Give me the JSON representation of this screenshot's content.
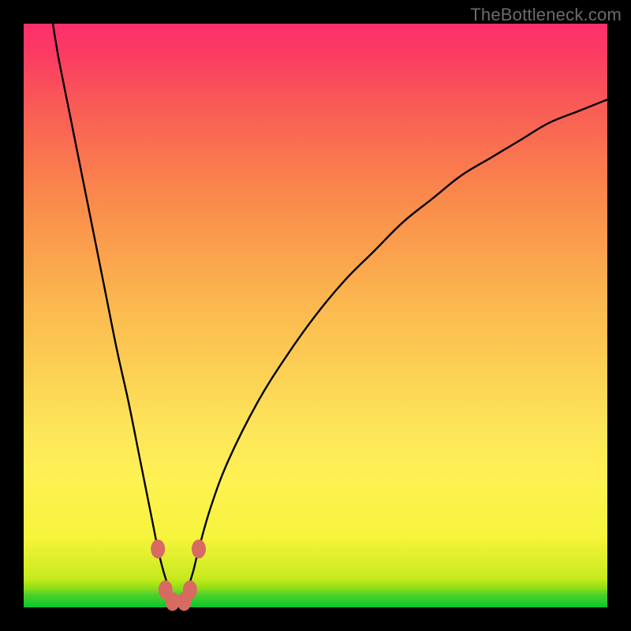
{
  "watermark": "TheBottleneck.com",
  "colors": {
    "frame": "#000000",
    "curve_stroke": "#000000",
    "marker_fill": "#d86a62",
    "marker_stroke": "#d86a62"
  },
  "chart_data": {
    "type": "line",
    "title": "",
    "xlabel": "",
    "ylabel": "",
    "xlim": [
      0,
      100
    ],
    "ylim": [
      0,
      100
    ],
    "grid": false,
    "x": [
      5,
      6,
      8,
      10,
      12,
      14,
      16,
      18,
      20,
      22,
      23,
      24,
      25,
      26,
      27,
      28,
      29,
      30,
      32,
      35,
      40,
      45,
      50,
      55,
      60,
      65,
      70,
      75,
      80,
      85,
      90,
      95,
      100
    ],
    "values": [
      100,
      94,
      84,
      74,
      64,
      54,
      44,
      35,
      25,
      15,
      10,
      6,
      3,
      1,
      1,
      3,
      6,
      10,
      17,
      25,
      35,
      43,
      50,
      56,
      61,
      66,
      70,
      74,
      77,
      80,
      83,
      85,
      87
    ],
    "vertex_x": 26,
    "vertex_y": 1,
    "markers": [
      {
        "x": 23.0,
        "y": 10.0
      },
      {
        "x": 24.3,
        "y": 3.0
      },
      {
        "x": 25.5,
        "y": 1.0
      },
      {
        "x": 27.5,
        "y": 1.0
      },
      {
        "x": 28.5,
        "y": 3.0
      },
      {
        "x": 30.0,
        "y": 10.0
      }
    ]
  }
}
